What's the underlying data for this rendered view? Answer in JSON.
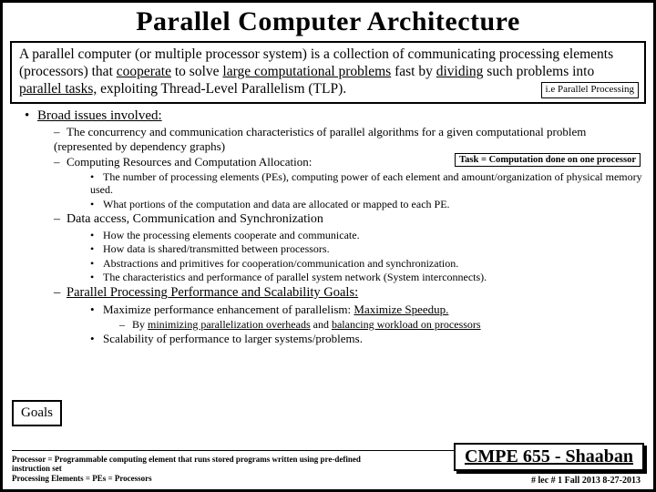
{
  "title": "Parallel Computer Architecture",
  "intro": {
    "text_plain": "A parallel computer (or multiple processor system) is a collection of communicating processing elements (processors) that cooperate to solve large computational problems fast by dividing such problems into parallel tasks, exploiting Thread-Level Parallelism (TLP).",
    "note": "i.e Parallel Processing"
  },
  "task_note": "Task = Computation done on one processor",
  "broad_label": "Broad issues involved:",
  "items": {
    "i1": "The concurrency and communication characteristics of parallel algorithms for a given computational problem (represented by dependency graphs)",
    "i2": "Computing Resources and Computation Allocation:",
    "i2a": "The number of processing elements (PEs), computing power of each element and amount/organization of physical memory used.",
    "i2b": "What portions of the computation and data are allocated or mapped to each PE.",
    "i3": "Data access, Communication and Synchronization",
    "i3a": "How the processing elements cooperate and communicate.",
    "i3b": "How data is shared/transmitted between processors.",
    "i3c": "Abstractions and primitives for cooperation/communication and synchronization.",
    "i3d": "The characteristics and performance of parallel system network (System interconnects).",
    "i4": "Parallel Processing Performance and Scalability Goals:",
    "i4a_pre": "Maximize performance enhancement of parallelism:  ",
    "i4a_u": "Maximize Speedup.",
    "i4b_pre": "By ",
    "i4b_u1": "minimizing parallelization overheads",
    "i4b_mid": " and ",
    "i4b_u2": "balancing workload on processors",
    "i4c": "Scalability of performance to larger systems/problems."
  },
  "goals": "Goals",
  "footer": {
    "proc_def": "Processor =  Programmable computing element that runs stored programs written using pre-defined instruction set",
    "pe_def": "Processing Elements = PEs = Processors"
  },
  "course": "CMPE 655 - Shaaban",
  "lec": "#  lec # 1   Fall 2013   8-27-2013"
}
